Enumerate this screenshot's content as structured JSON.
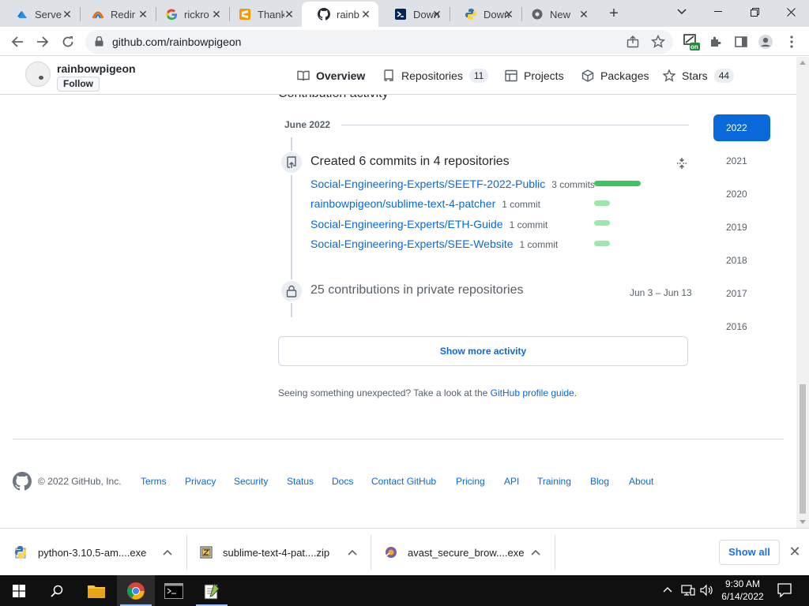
{
  "browser": {
    "tabs": [
      {
        "label": "Serve",
        "icon": "azure-icon"
      },
      {
        "label": "Redir",
        "icon": "redirect-icon"
      },
      {
        "label": "rickro",
        "icon": "google-icon"
      },
      {
        "label": "Thank",
        "icon": "sublime-icon"
      },
      {
        "label": "rainb",
        "icon": "github-icon",
        "active": true
      },
      {
        "label": "Down",
        "icon": "powershell-icon"
      },
      {
        "label": "Down",
        "icon": "python-icon"
      },
      {
        "label": "New",
        "icon": "chrome-icon"
      }
    ],
    "url": "github.com/rainbowpigeon",
    "extension_badge": "on"
  },
  "profile_header": {
    "username": "rainbowpigeon",
    "follow_label": "Follow",
    "tabs": [
      {
        "label": "Overview",
        "icon": "book-icon"
      },
      {
        "label": "Repositories",
        "icon": "repo-icon",
        "count": "11"
      },
      {
        "label": "Projects",
        "icon": "table-icon"
      },
      {
        "label": "Packages",
        "icon": "package-icon"
      },
      {
        "label": "Stars",
        "icon": "star-icon",
        "count": "44"
      }
    ]
  },
  "activity": {
    "section_heading": "Contribution activity",
    "month": "June 2022",
    "created_title": "Created 6 commits in 4 repositories",
    "repos": [
      {
        "name": "Social-Engineering-Experts/SEETF-2022-Public",
        "commits": "3 commits",
        "share": 1.0
      },
      {
        "name": "rainbowpigeon/sublime-text-4-patcher",
        "commits": "1 commit",
        "share": 0.33
      },
      {
        "name": "Social-Engineering-Experts/ETH-Guide",
        "commits": "1 commit",
        "share": 0.33
      },
      {
        "name": "Social-Engineering-Experts/SEE-Website",
        "commits": "1 commit",
        "share": 0.33
      }
    ],
    "private_title": "25 contributions in private repositories",
    "private_range": "Jun 3 – Jun 13",
    "show_more": "Show more activity",
    "unexpected_text": "Seeing something unexpected? Take a look at the ",
    "unexpected_link": "GitHub profile guide",
    "unexpected_end": "."
  },
  "years": [
    "2022",
    "2021",
    "2020",
    "2019",
    "2018",
    "2017",
    "2016"
  ],
  "selected_year": "2022",
  "footer": {
    "copyright": "© 2022 GitHub, Inc.",
    "links": [
      "Terms",
      "Privacy",
      "Security",
      "Status",
      "Docs",
      "Contact GitHub",
      "Pricing",
      "API",
      "Training",
      "Blog",
      "About"
    ]
  },
  "downloads": {
    "items": [
      {
        "name": "python-3.10.5-am....exe",
        "icon": "python-installer-icon"
      },
      {
        "name": "sublime-text-4-pat....zip",
        "icon": "zip-icon"
      },
      {
        "name": "avast_secure_brow....exe",
        "icon": "avast-installer-icon"
      }
    ],
    "show_all": "Show all"
  },
  "taskbar": {
    "time": "9:30 AM",
    "date": "6/14/2022"
  },
  "colors": {
    "accent": "#0969da",
    "bar_strong": "#40c463",
    "bar_light": "#9be9a8"
  }
}
